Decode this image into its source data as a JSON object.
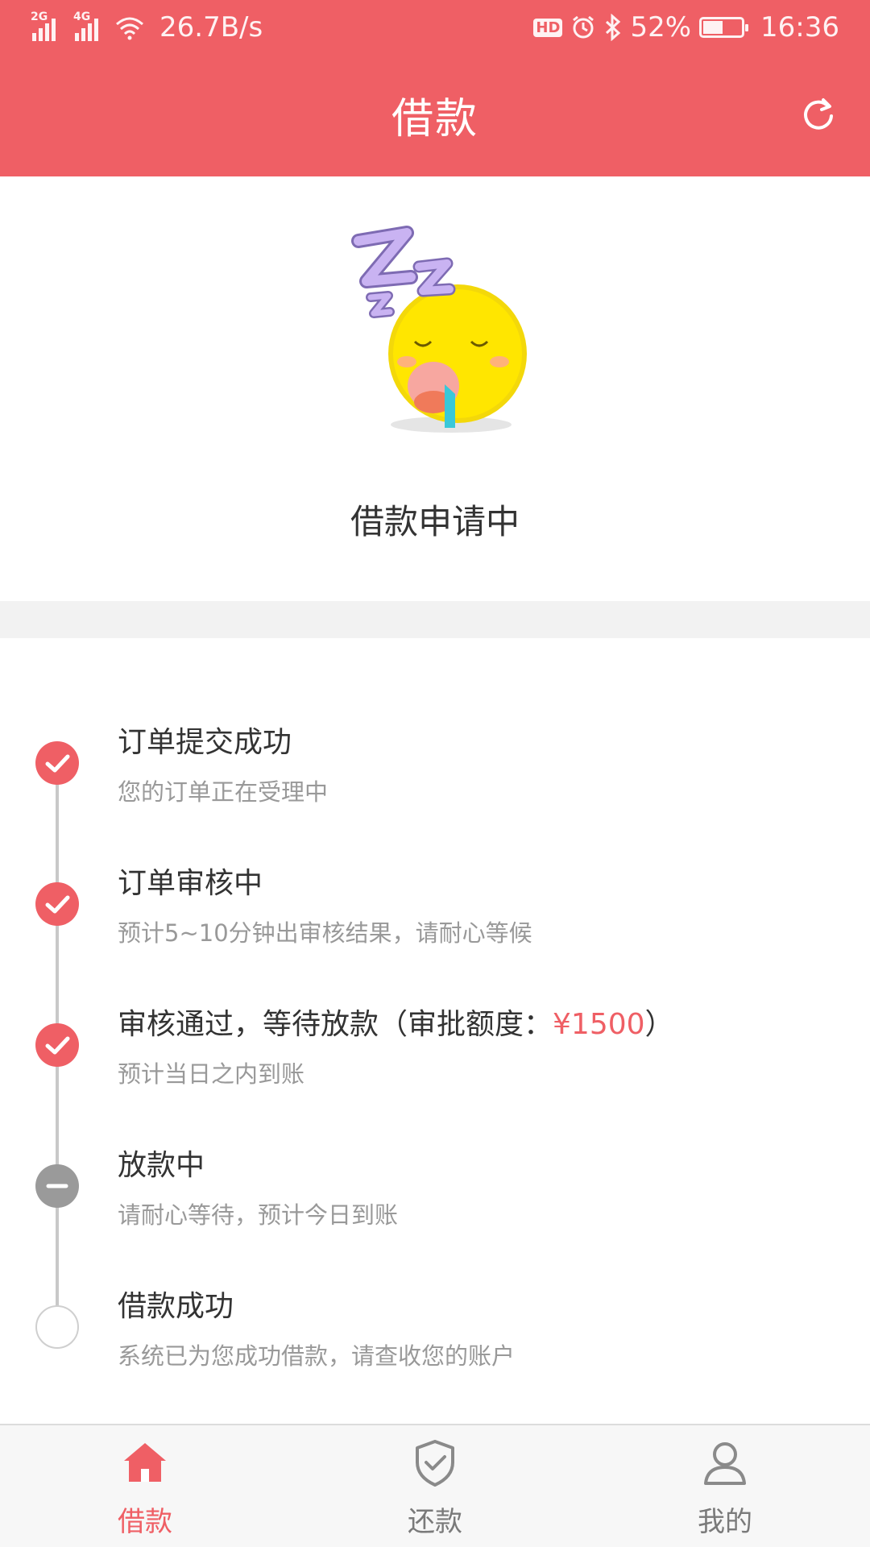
{
  "status_bar": {
    "network_1": "2G",
    "network_2": "4G",
    "speed": "26.7B/s",
    "hd": "HD",
    "battery": "52%",
    "battery_level": 0.52,
    "time": "16:36"
  },
  "header": {
    "title": "借款",
    "refresh_icon": "refresh-icon"
  },
  "hero": {
    "illustration": "sleeping-emoji",
    "status_text": "借款申请中"
  },
  "timeline": {
    "steps": [
      {
        "title": "订单提交成功",
        "desc": "您的订单正在受理中",
        "state": "done"
      },
      {
        "title": "订单审核中",
        "desc": "预计5~10分钟出审核结果，请耐心等候",
        "state": "done"
      },
      {
        "title_prefix": "审核通过，等待放款（审批额度：",
        "amount": "¥1500",
        "title_suffix": "）",
        "desc": "预计当日之内到账",
        "state": "done"
      },
      {
        "title": "放款中",
        "desc": "请耐心等待，预计今日到账",
        "state": "active"
      },
      {
        "title": "借款成功",
        "desc": "系统已为您成功借款，请查收您的账户",
        "state": "pending"
      }
    ]
  },
  "tabbar": {
    "tabs": [
      {
        "label": "借款",
        "icon": "home-icon",
        "active": true
      },
      {
        "label": "还款",
        "icon": "shield-check-icon",
        "active": false
      },
      {
        "label": "我的",
        "icon": "user-icon",
        "active": false
      }
    ]
  },
  "colors": {
    "accent": "#ef5f65",
    "muted": "#999999",
    "text": "#333333"
  }
}
